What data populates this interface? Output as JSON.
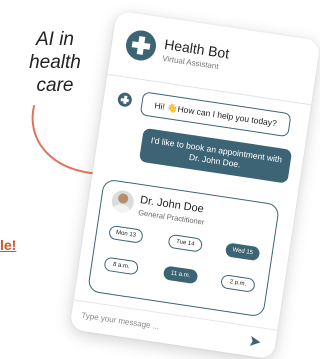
{
  "caption": {
    "line1": "AI in",
    "line2": "health",
    "line3": "care"
  },
  "cut_link_text": "le!",
  "header": {
    "title": "Health Bot",
    "subtitle": "Virtual Assistant"
  },
  "messages": {
    "bot": "Hi! 👋How can I help you today?",
    "user": "I'd like to book an appointment with Dr. John Doe."
  },
  "doctor": {
    "name": "Dr. John Doe",
    "role": "General Practitioner"
  },
  "dates": [
    "Mon 13",
    "Tue 14",
    "Wed 15"
  ],
  "times": [
    "8 a.m.",
    "11 a.m.",
    "2 p.m."
  ],
  "input": {
    "placeholder": "Type your message ..."
  },
  "colors": {
    "primary": "#3d6475",
    "accent": "#d4532b"
  },
  "icons": {
    "bot": "medical-cross-icon",
    "send": "send-arrow-icon"
  }
}
